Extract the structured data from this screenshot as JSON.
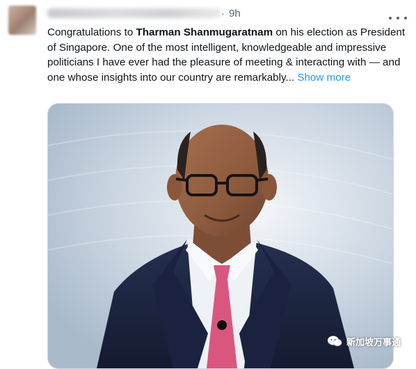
{
  "tweet": {
    "time": "9h",
    "separator": "·",
    "text_before": "Congratulations to ",
    "text_bold": "Tharman Shanmugaratnam",
    "text_after": " on his election as President of Singapore. One of the most intelligent, knowledgeable and impressive politicians I have ever had the pleasure of meeting & interacting with — and one whose insights into our country are remarkably...",
    "show_more": " Show more"
  },
  "icons": {
    "more": "more-horizontal-icon",
    "watermark": "wechat-icon"
  },
  "watermark": {
    "text": "新加坡万事通"
  },
  "colors": {
    "link": "#1d9bf0",
    "text": "#0f1419",
    "secondary": "#536471",
    "suit": "#1c2440",
    "tie": "#d9577e"
  }
}
